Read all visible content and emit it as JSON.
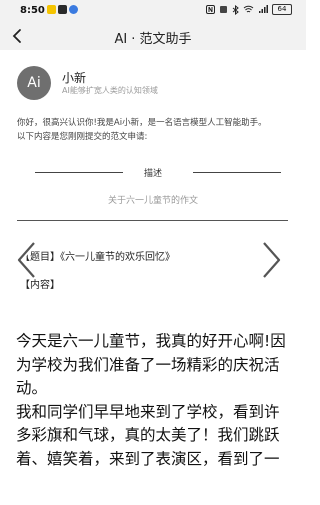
{
  "status": {
    "time": "8:50",
    "battery": "64",
    "left_icons": [
      "app-icon-1",
      "app-icon-2",
      "message-icon"
    ],
    "right_icons": [
      "nfc-icon",
      "mute-icon",
      "bluetooth-icon",
      "wifi-icon",
      "signal-icon",
      "battery-icon"
    ]
  },
  "nav": {
    "title": "AI · 范文助手",
    "back_icon": "chevron-left-icon"
  },
  "bot": {
    "avatar_text": "Ai",
    "name": "小新",
    "subtitle": "AI能够扩宽人类的认知领域"
  },
  "intro": {
    "line1": "你好，很高兴认识你!我是Ai小新，是一名语言模型人工智能助手。",
    "line2": "以下内容是您刚刚提交的范文申请:"
  },
  "description": {
    "label": "描述",
    "text": "关于六一儿童节的作文"
  },
  "essay": {
    "title_line": "【题目】《六一儿童节的欢乐回忆》",
    "content_label": "【内容】",
    "paragraph1": "今天是六一儿童节，我真的好开心啊!因为学校为我们准备了一场精彩的庆祝活动。",
    "paragraph2": "我和同学们早早地来到了学校，看到许多彩旗和气球，真的太美了！我们跳跃着、嬉笑着，来到了表演区，看到了一"
  },
  "arrows": {
    "prev_icon": "chevron-left-icon",
    "next_icon": "chevron-right-icon"
  },
  "colors": {
    "avatar_bg": "#6f6f6f",
    "header_bg": "#f2f2f2"
  }
}
